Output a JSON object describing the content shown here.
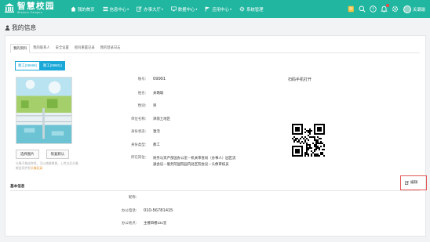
{
  "header": {
    "logo_main": "智慧校园",
    "logo_sub": "Wisdom Campus",
    "nav": [
      {
        "label": "我的首页",
        "icon": "home-icon",
        "caret": false
      },
      {
        "label": "信息中心",
        "icon": "list-icon",
        "caret": true
      },
      {
        "label": "办事大厅",
        "icon": "edit-icon",
        "caret": true
      },
      {
        "label": "数据中心",
        "icon": "monitor-icon",
        "caret": true
      },
      {
        "label": "应用中心",
        "icon": "flag-icon",
        "caret": true
      },
      {
        "label": "系统管理",
        "icon": "gear-icon",
        "caret": false
      }
    ],
    "username": "关璐瑜"
  },
  "page": {
    "title": "我的信息"
  },
  "tabs": [
    "我的资料",
    "我的联系人",
    "安全设置",
    "密码重置记录",
    "我的登录日志"
  ],
  "identities": [
    "教工(09999)",
    "教工(09901)"
  ],
  "photo": {
    "upload_label": "选择图片",
    "restore_label": "恢复默认",
    "tip_text": "头像不想这种类，可以随便换换。上传过后头像都会同步到",
    "tip_highlight": "头像纪录"
  },
  "profile": {
    "fields": [
      {
        "label": "账号：",
        "value": "09901"
      },
      {
        "label": "姓名：",
        "value": "关璐瑜"
      },
      {
        "label": "性别：",
        "value": "男"
      },
      {
        "label": "单位名称：",
        "value": "津南土地区"
      },
      {
        "label": "身份状态：",
        "value": "激活"
      },
      {
        "label": "身份类型：",
        "value": "教工"
      }
    ],
    "group_label": "所在岗位：",
    "group_line1": "财务与资产部国办公室－机关审查局（办事人）园区流",
    "group_line2": "通会议－服务院国院园内处区院会议－头像审核员"
  },
  "qr": {
    "title": "扫码手机打开"
  },
  "basic": {
    "title": "基本信息",
    "edit_label": "编辑",
    "fields": [
      {
        "label": "昵称：",
        "value": ""
      },
      {
        "label": "办公电话：",
        "value": "010-56781415"
      },
      {
        "label": "办公地点：",
        "value": "主楼四楼231室"
      }
    ]
  },
  "colors": {
    "header_bg": "#21b6a0",
    "accent_blue": "#1aa8d8",
    "edit_highlight": "#e35555"
  }
}
